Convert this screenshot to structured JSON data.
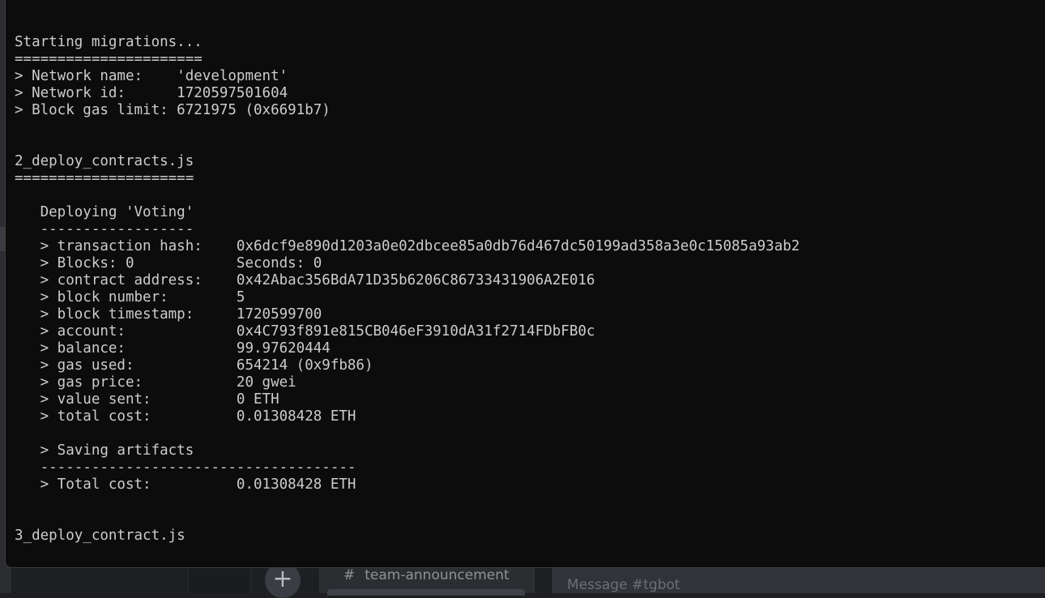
{
  "terminal": {
    "lines": [
      "Starting migrations...",
      "======================",
      "> Network name:    'development'",
      "> Network id:      1720597501604",
      "> Block gas limit: 6721975 (0x6691b7)",
      "",
      "",
      "2_deploy_contracts.js",
      "=====================",
      "",
      "   Deploying 'Voting'",
      "   ------------------",
      "   > transaction hash:    0x6dcf9e890d1203a0e02dbcee85a0db76d467dc50199ad358a3e0c15085a93ab2",
      "   > Blocks: 0            Seconds: 0",
      "   > contract address:    0x42Abac356BdA71D35b6206C86733431906A2E016",
      "   > block number:        5",
      "   > block timestamp:     1720599700",
      "   > account:             0x4C793f891e815CB046eF3910dA31f2714FDbFB0c",
      "   > balance:             99.97620444",
      "   > gas used:            654214 (0x9fb86)",
      "   > gas price:           20 gwei",
      "   > value sent:          0 ETH",
      "   > total cost:          0.01308428 ETH",
      "",
      "   > Saving artifacts",
      "   -------------------------------------",
      "   > Total cost:          0.01308428 ETH",
      "",
      "",
      "3_deploy_contract.js"
    ]
  },
  "background_app": {
    "add_button": "+",
    "channel": {
      "hash": "#",
      "name": "team-announcement"
    },
    "message_placeholder": "Message #tgbot"
  }
}
